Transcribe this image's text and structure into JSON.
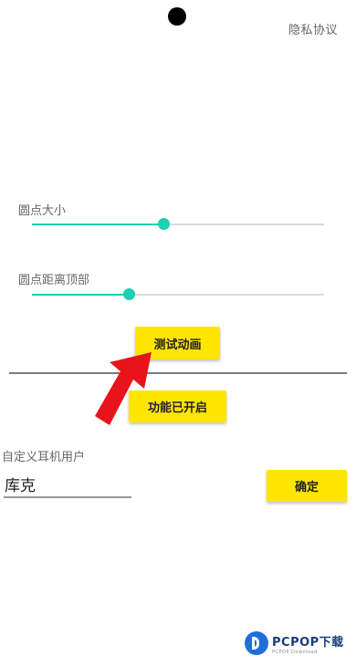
{
  "header": {
    "privacy_label": "隐私协议"
  },
  "dot_size": {
    "label": "圆点大小",
    "value_fraction": 0.45
  },
  "dot_distance": {
    "label": "圆点距离顶部",
    "value_fraction": 0.33
  },
  "buttons": {
    "test_animation": "测试动画",
    "feature_enabled": "功能已开启",
    "confirm": "确定"
  },
  "custom_user": {
    "label": "自定义耳机用户",
    "value": "库克"
  },
  "watermark": {
    "main": "PCPOP下载",
    "sub": "PCPOP Download"
  },
  "colors": {
    "accent": "#1ecfb2",
    "button": "#ffe600",
    "arrow": "#e8131b"
  }
}
